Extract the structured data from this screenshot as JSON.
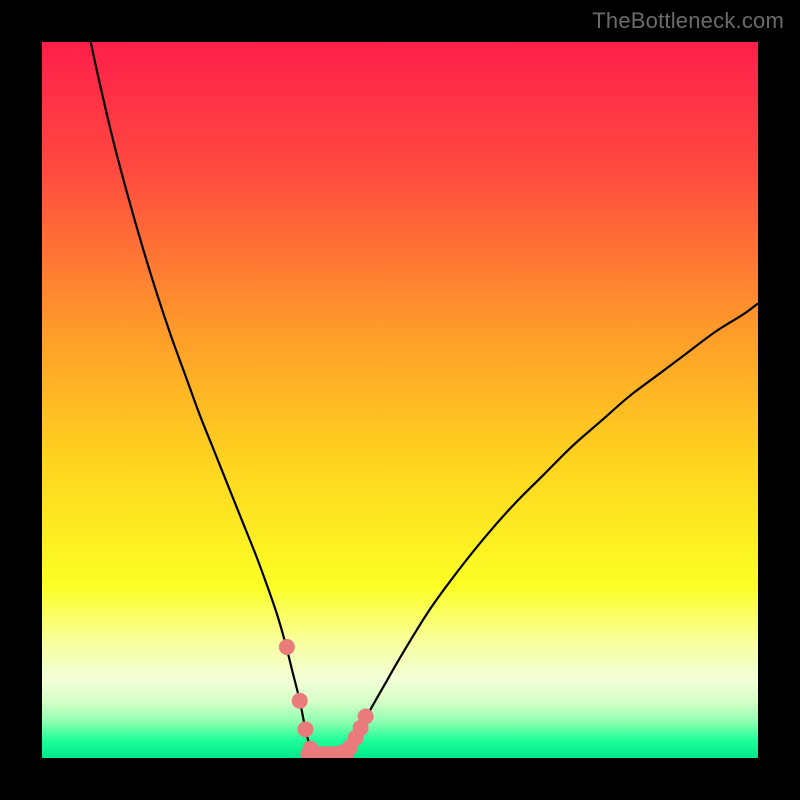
{
  "watermark": "TheBottleneck.com",
  "chart_data": {
    "type": "line",
    "title": "",
    "xlabel": "",
    "ylabel": "",
    "xlim": [
      0,
      100
    ],
    "ylim": [
      0,
      100
    ],
    "grid": false,
    "legend": false,
    "gradient_stops": [
      {
        "offset": 0.0,
        "color": "#ff1f4b"
      },
      {
        "offset": 0.18,
        "color": "#ff4a3f"
      },
      {
        "offset": 0.4,
        "color": "#ff9a2a"
      },
      {
        "offset": 0.58,
        "color": "#ffd21f"
      },
      {
        "offset": 0.76,
        "color": "#fcff24"
      },
      {
        "offset": 0.84,
        "color": "#f8ffa0"
      },
      {
        "offset": 0.89,
        "color": "#f2ffd8"
      },
      {
        "offset": 0.92,
        "color": "#d8ffc7"
      },
      {
        "offset": 0.95,
        "color": "#8cffb0"
      },
      {
        "offset": 0.975,
        "color": "#1fff9a"
      },
      {
        "offset": 1.0,
        "color": "#00e88a"
      }
    ],
    "series": [
      {
        "name": "bottleneck-curve",
        "type": "line",
        "color": "#000000",
        "x": [
          6.8,
          8,
          10,
          12,
          14,
          16,
          18,
          20,
          22,
          24,
          26,
          28,
          30,
          32,
          33,
          34,
          35,
          36,
          36.8,
          37.5,
          38.5,
          39.5,
          41.5,
          43,
          44,
          45,
          46,
          48,
          50,
          54,
          58,
          62,
          66,
          70,
          74,
          78,
          82,
          86,
          90,
          94,
          98,
          100
        ],
        "y": [
          100,
          94.5,
          86,
          78.5,
          71.5,
          65,
          59,
          53.5,
          48,
          43,
          38,
          33,
          28,
          22.5,
          19.5,
          16,
          12,
          8,
          4,
          1.5,
          0.5,
          0.5,
          0.5,
          1.5,
          3,
          5,
          7,
          10.5,
          14,
          20.5,
          26,
          31,
          35.5,
          39.5,
          43.5,
          47,
          50.5,
          53.5,
          56.5,
          59.5,
          62,
          63.5
        ]
      },
      {
        "name": "measured-points",
        "type": "scatter",
        "color": "#e97b7c",
        "x": [
          34.2,
          36.0,
          36.8,
          37.5,
          38.5,
          39.5,
          40.8,
          42.0,
          43.0,
          43.8,
          44.5,
          45.2
        ],
        "y": [
          15.5,
          8.0,
          4.0,
          1.3,
          0.5,
          0.5,
          0.5,
          0.8,
          1.5,
          2.8,
          4.2,
          5.8
        ]
      }
    ],
    "flat_bottom": {
      "color": "#e97b7c",
      "x_start": 37.2,
      "x_end": 42.5,
      "y": 0.5
    }
  }
}
